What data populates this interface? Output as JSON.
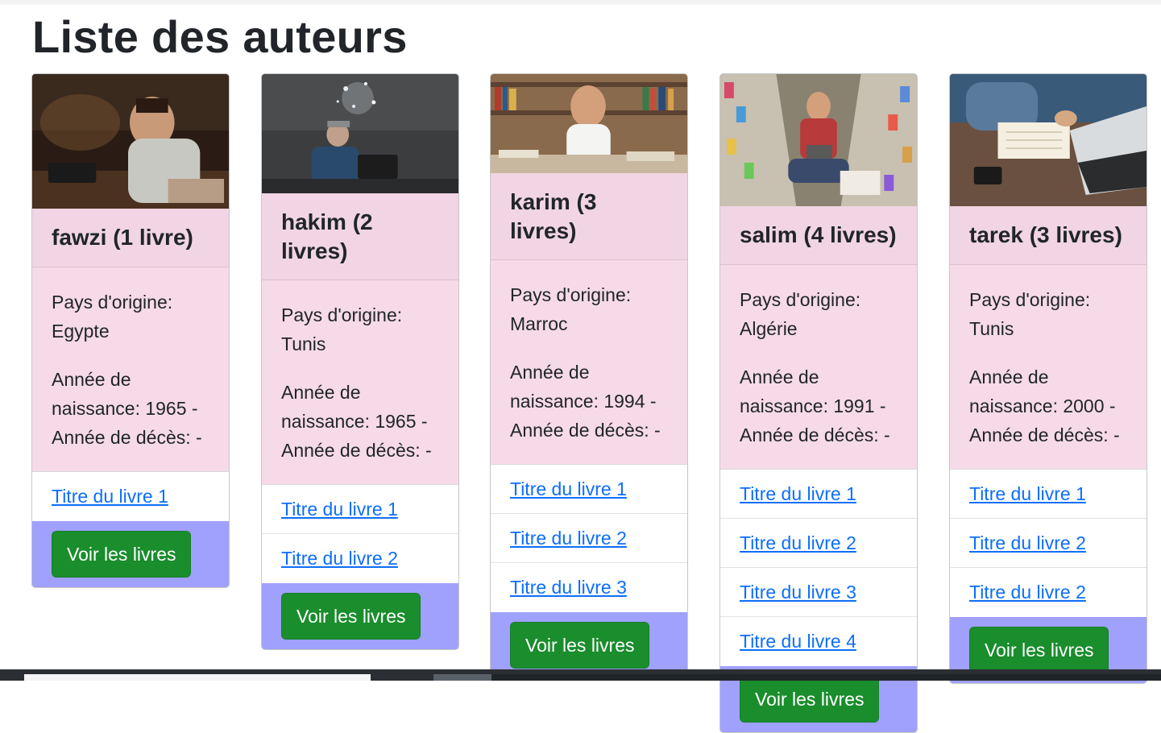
{
  "page": {
    "title": "Liste des auteurs"
  },
  "labels": {
    "country_prefix": "Pays d'origine:",
    "birth_prefix": "Année de naissance:",
    "death_prefix": "Année de décès:",
    "button": "Voir les livres"
  },
  "authors": [
    {
      "header": "fawzi (1 livre)",
      "country_line": "Pays d'origine: Egypte",
      "years_line": "Année de naissance: 1965 - Année de décès: -",
      "books": [
        "Titre du livre 1"
      ],
      "button": "Voir les livres",
      "image_alt": "writer-with-typewriter-photo"
    },
    {
      "header": "hakim (2 livres)",
      "country_line": "Pays d'origine: Tunis",
      "years_line": "Année de naissance: 1965 - Année de décès: -",
      "books": [
        "Titre du livre 1",
        "Titre du livre 2"
      ],
      "button": "Voir les livres",
      "image_alt": "typewriter-sparks-photo"
    },
    {
      "header": "karim (3 livres)",
      "country_line": "Pays d'origine: Marroc",
      "years_line": "Année de naissance: 1994 - Année de décès: -",
      "books": [
        "Titre du livre 1",
        "Titre du livre 2",
        "Titre du livre 3"
      ],
      "button": "Voir les livres",
      "image_alt": "smiling-man-library-photo"
    },
    {
      "header": "salim (4 livres)",
      "country_line": "Pays d'origine: Algérie",
      "years_line": "Année de naissance: 1991 - Année de décès: -",
      "books": [
        "Titre du livre 1",
        "Titre du livre 2",
        "Titre du livre 3",
        "Titre du livre 4"
      ],
      "button": "Voir les livres",
      "image_alt": "man-laptop-bookstore-photo"
    },
    {
      "header": "tarek (3 livres)",
      "country_line": "Pays d'origine: Tunis",
      "years_line": "Année de naissance: 2000 - Année de décès: -",
      "books": [
        "Titre du livre 1",
        "Titre du livre 2",
        "Titre du livre 2"
      ],
      "button": "Voir les livres",
      "image_alt": "hand-writing-notebook-laptop-photo"
    }
  ],
  "colors": {
    "card_header": "#f1d5e4",
    "card_body": "#f6dae8",
    "card_footer": "#a0a0fd",
    "button": "#1a8d2d",
    "link": "#0d6efd"
  }
}
